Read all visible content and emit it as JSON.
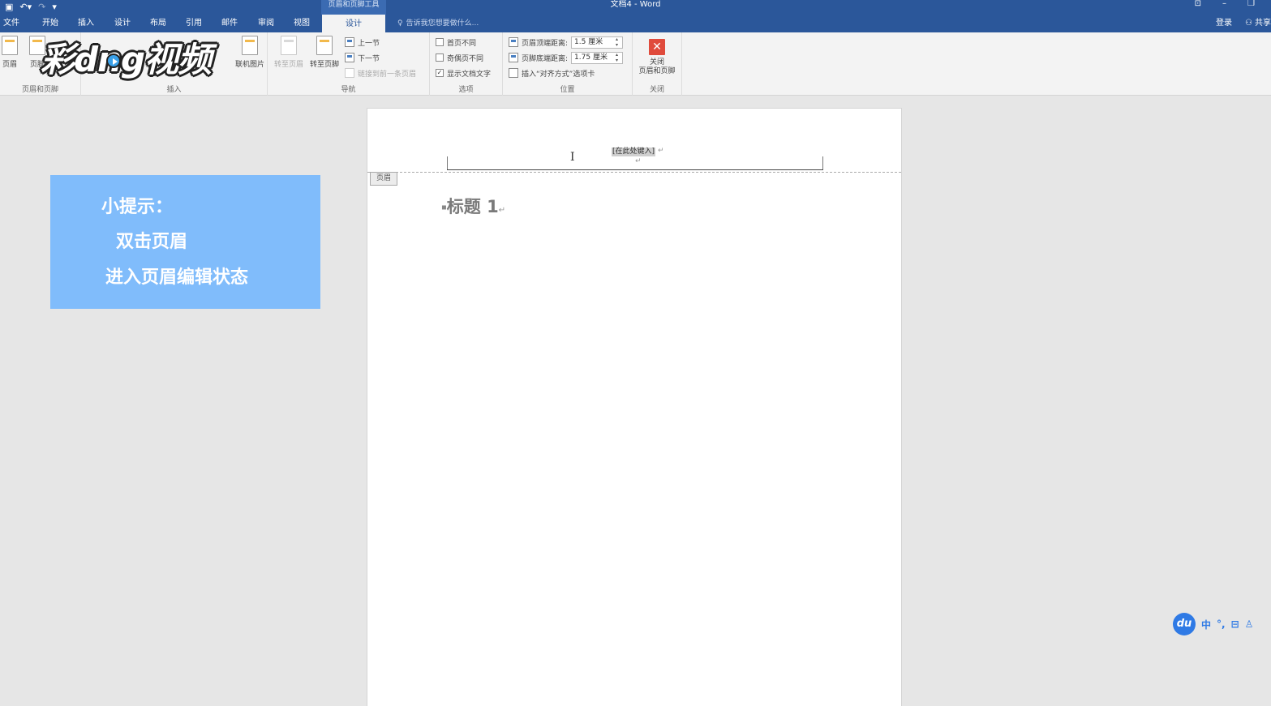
{
  "title_bar": {
    "doc_title": "文档4 - Word",
    "context_tool": "页眉和页脚工具",
    "qat_icons": [
      "save-icon",
      "undo-icon",
      "redo-icon",
      "customize-icon"
    ],
    "window_buttons": [
      "⊡",
      "–",
      "❐"
    ]
  },
  "tabs": {
    "items": [
      "文件",
      "开始",
      "插入",
      "设计",
      "布局",
      "引用",
      "邮件",
      "审阅",
      "视图",
      "设计"
    ],
    "active_index": 9,
    "tell_me": "告诉我您想要做什么...",
    "sign_in": "登录",
    "share": "共享"
  },
  "ribbon": {
    "group_header_footer": {
      "label": "页眉和页脚",
      "header_btn": "页眉",
      "footer_btn": "页脚"
    },
    "group_insert": {
      "label": "插入",
      "online_pictures": "联机图片"
    },
    "group_nav": {
      "label": "导航",
      "goto_header": "转至页眉",
      "goto_footer": "转至页脚",
      "prev_section": "上一节",
      "next_section": "下一节",
      "link_previous": "链接到前一条页眉"
    },
    "group_options": {
      "label": "选项",
      "diff_first": "首页不同",
      "diff_odd_even": "奇偶页不同",
      "show_text": "显示文档文字",
      "diff_first_checked": false,
      "diff_odd_even_checked": false,
      "show_text_checked": true
    },
    "group_position": {
      "label": "位置",
      "header_top_label": "页眉顶端距离:",
      "header_top_value": "1.5 厘米",
      "footer_bottom_label": "页脚底端距离:",
      "footer_bottom_value": "1.75 厘米",
      "insert_tab": "插入“对齐方式”选项卡"
    },
    "group_close": {
      "label": "关闭",
      "close_line1": "关闭",
      "close_line2": "页眉和页脚"
    }
  },
  "tip_box": {
    "line1": "小提示：",
    "line2": "双击页眉",
    "line3": "进入页眉编辑状态",
    "color": "#80bcfb"
  },
  "document": {
    "header_placeholder": "[在此处键入]",
    "header_tag": "页眉",
    "heading": "标题 1",
    "paragraph_mark": "↵"
  },
  "ime_bar": {
    "logo": "du",
    "items": [
      "中",
      "°,",
      "⊟",
      "♙"
    ]
  },
  "watermark": {
    "text": "彩dng视频"
  },
  "colors": {
    "accent": "#2b579a",
    "close_red": "#e04b3c",
    "ime_blue": "#2f7ae5"
  }
}
